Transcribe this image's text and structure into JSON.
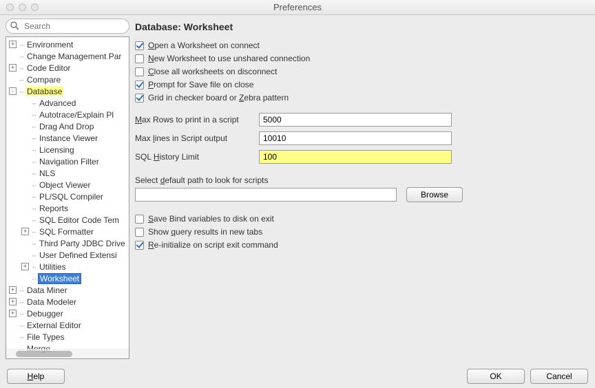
{
  "window": {
    "title": "Preferences"
  },
  "search": {
    "placeholder": "Search"
  },
  "tree": {
    "items": [
      {
        "label": "Environment",
        "depth": 0,
        "toggle": "+",
        "hl": ""
      },
      {
        "label": "Change Management Par",
        "depth": 0,
        "toggle": "",
        "hl": ""
      },
      {
        "label": "Code Editor",
        "depth": 0,
        "toggle": "+",
        "hl": ""
      },
      {
        "label": "Compare",
        "depth": 0,
        "toggle": "",
        "hl": ""
      },
      {
        "label": "Database",
        "depth": 0,
        "toggle": "-",
        "hl": "yellow"
      },
      {
        "label": "Advanced",
        "depth": 1,
        "toggle": "",
        "hl": ""
      },
      {
        "label": "Autotrace/Explain Pl",
        "depth": 1,
        "toggle": "",
        "hl": ""
      },
      {
        "label": "Drag And Drop",
        "depth": 1,
        "toggle": "",
        "hl": ""
      },
      {
        "label": "Instance Viewer",
        "depth": 1,
        "toggle": "",
        "hl": ""
      },
      {
        "label": "Licensing",
        "depth": 1,
        "toggle": "",
        "hl": ""
      },
      {
        "label": "Navigation Filter",
        "depth": 1,
        "toggle": "",
        "hl": ""
      },
      {
        "label": "NLS",
        "depth": 1,
        "toggle": "",
        "hl": ""
      },
      {
        "label": "Object Viewer",
        "depth": 1,
        "toggle": "",
        "hl": ""
      },
      {
        "label": "PL/SQL Compiler",
        "depth": 1,
        "toggle": "",
        "hl": ""
      },
      {
        "label": "Reports",
        "depth": 1,
        "toggle": "",
        "hl": ""
      },
      {
        "label": "SQL Editor Code Tem",
        "depth": 1,
        "toggle": "",
        "hl": ""
      },
      {
        "label": "SQL Formatter",
        "depth": 1,
        "toggle": "+",
        "hl": ""
      },
      {
        "label": "Third Party JDBC Drive",
        "depth": 1,
        "toggle": "",
        "hl": ""
      },
      {
        "label": "User Defined Extensi",
        "depth": 1,
        "toggle": "",
        "hl": ""
      },
      {
        "label": "Utilities",
        "depth": 1,
        "toggle": "+",
        "hl": ""
      },
      {
        "label": "Worksheet",
        "depth": 1,
        "toggle": "",
        "hl": "sel"
      },
      {
        "label": "Data Miner",
        "depth": 0,
        "toggle": "+",
        "hl": ""
      },
      {
        "label": "Data Modeler",
        "depth": 0,
        "toggle": "+",
        "hl": ""
      },
      {
        "label": "Debugger",
        "depth": 0,
        "toggle": "+",
        "hl": ""
      },
      {
        "label": "External Editor",
        "depth": 0,
        "toggle": "",
        "hl": ""
      },
      {
        "label": "File Types",
        "depth": 0,
        "toggle": "",
        "hl": ""
      },
      {
        "label": "Merge",
        "depth": 0,
        "toggle": "",
        "hl": ""
      }
    ]
  },
  "panel": {
    "heading": "Database: Worksheet",
    "chk_open": {
      "pre": "",
      "u": "O",
      "post": "pen a Worksheet on connect",
      "checked": true
    },
    "chk_new": {
      "pre": "",
      "u": "N",
      "post": "ew Worksheet to use unshared connection",
      "checked": false
    },
    "chk_close": {
      "pre": "",
      "u": "C",
      "post": "lose all worksheets on disconnect",
      "checked": false
    },
    "chk_prompt": {
      "pre": "",
      "u": "P",
      "post": "rompt for Save file on close",
      "checked": true
    },
    "chk_grid": {
      "pre": "Grid in checker board or ",
      "u": "Z",
      "post": "ebra pattern",
      "checked": true
    },
    "max_rows": {
      "lpre": "",
      "lu": "M",
      "lpost": "ax Rows to print in a script",
      "value": "5000"
    },
    "max_lines": {
      "lpre": "Max ",
      "lu": "l",
      "lpost": "ines in Script output",
      "value": "10010"
    },
    "hist": {
      "lpre": "SQL ",
      "lu": "H",
      "lpost": "istory Limit",
      "value": "100"
    },
    "scripts": {
      "lpre": "Select ",
      "lu": "d",
      "lpost": "efault path to look for scripts",
      "value": ""
    },
    "browse": "Browse",
    "chk_savebind": {
      "pre": "",
      "u": "S",
      "post": "ave Bind variables to disk on exit",
      "checked": false
    },
    "chk_showq": {
      "pre": "Show ",
      "u": "q",
      "post": "uery results in new tabs",
      "checked": false
    },
    "chk_reinit": {
      "pre": "",
      "u": "R",
      "post": "e-initialize on script exit command",
      "checked": true
    }
  },
  "footer": {
    "help": {
      "pre": "",
      "u": "H",
      "post": "elp"
    },
    "ok": "OK",
    "cancel": "Cancel"
  }
}
